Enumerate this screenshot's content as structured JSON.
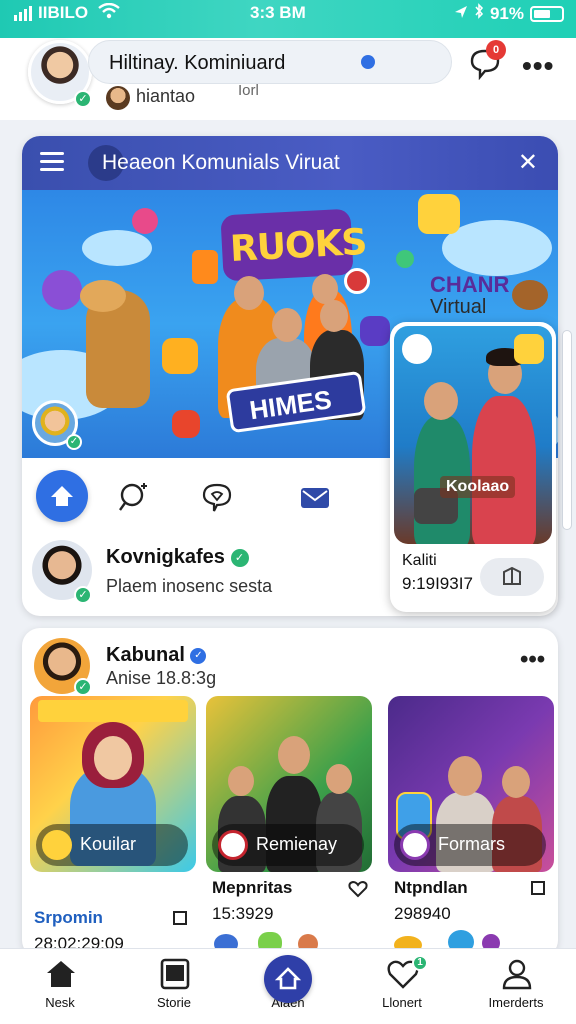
{
  "status_bar": {
    "carrier": "IIBILO",
    "time": "3:3 BM",
    "battery": "91%"
  },
  "header": {
    "profile_name": "Hiltinay. Kominiuard",
    "handle": "hiantao",
    "sub_label": "Iorl",
    "notif_count": "0"
  },
  "feature_card": {
    "title": "Heaeon Komunials Viruat",
    "banner_title": "RUOKS",
    "banner_side_title": "CHANR",
    "banner_side_sub": "Virtual",
    "banner_ribbon": "HIMES",
    "poster_name": "Kovnigkafes",
    "poster_sub": "Plaem inosenc sesta",
    "side_card": {
      "caption": "Koolaao",
      "name": "Kaliti",
      "number": "9:19I93I7"
    }
  },
  "feed_card": {
    "author": "Kabunal",
    "subtitle": "Anise 18.8:3g",
    "tiles": [
      {
        "caption": "Kouilar",
        "title": "Srpomin",
        "number": "28:02:29:09",
        "colors": [
          "#ff9a3c",
          "#3bc9e8"
        ]
      },
      {
        "caption": "Remienay",
        "title": "Mepnritas",
        "number": "15:3929",
        "colors": [
          "#3da04a",
          "#e9c23a"
        ]
      },
      {
        "caption": "Formars",
        "title": "Ntpndlan",
        "number": "298940",
        "colors": [
          "#4b2a8a",
          "#c94f9a"
        ]
      }
    ]
  },
  "bottom_nav": {
    "items": [
      {
        "label": "Nesk"
      },
      {
        "label": "Storie"
      },
      {
        "label": "Alaen"
      },
      {
        "label": "Llonert"
      },
      {
        "label": "Imerderts"
      }
    ],
    "badge": "1"
  },
  "colors": {
    "accent": "#1fc9b3",
    "header_blue": "#3a4fae",
    "primary_blue": "#2f6fe3",
    "verified_green": "#2bb573",
    "alert_red": "#e53935"
  }
}
